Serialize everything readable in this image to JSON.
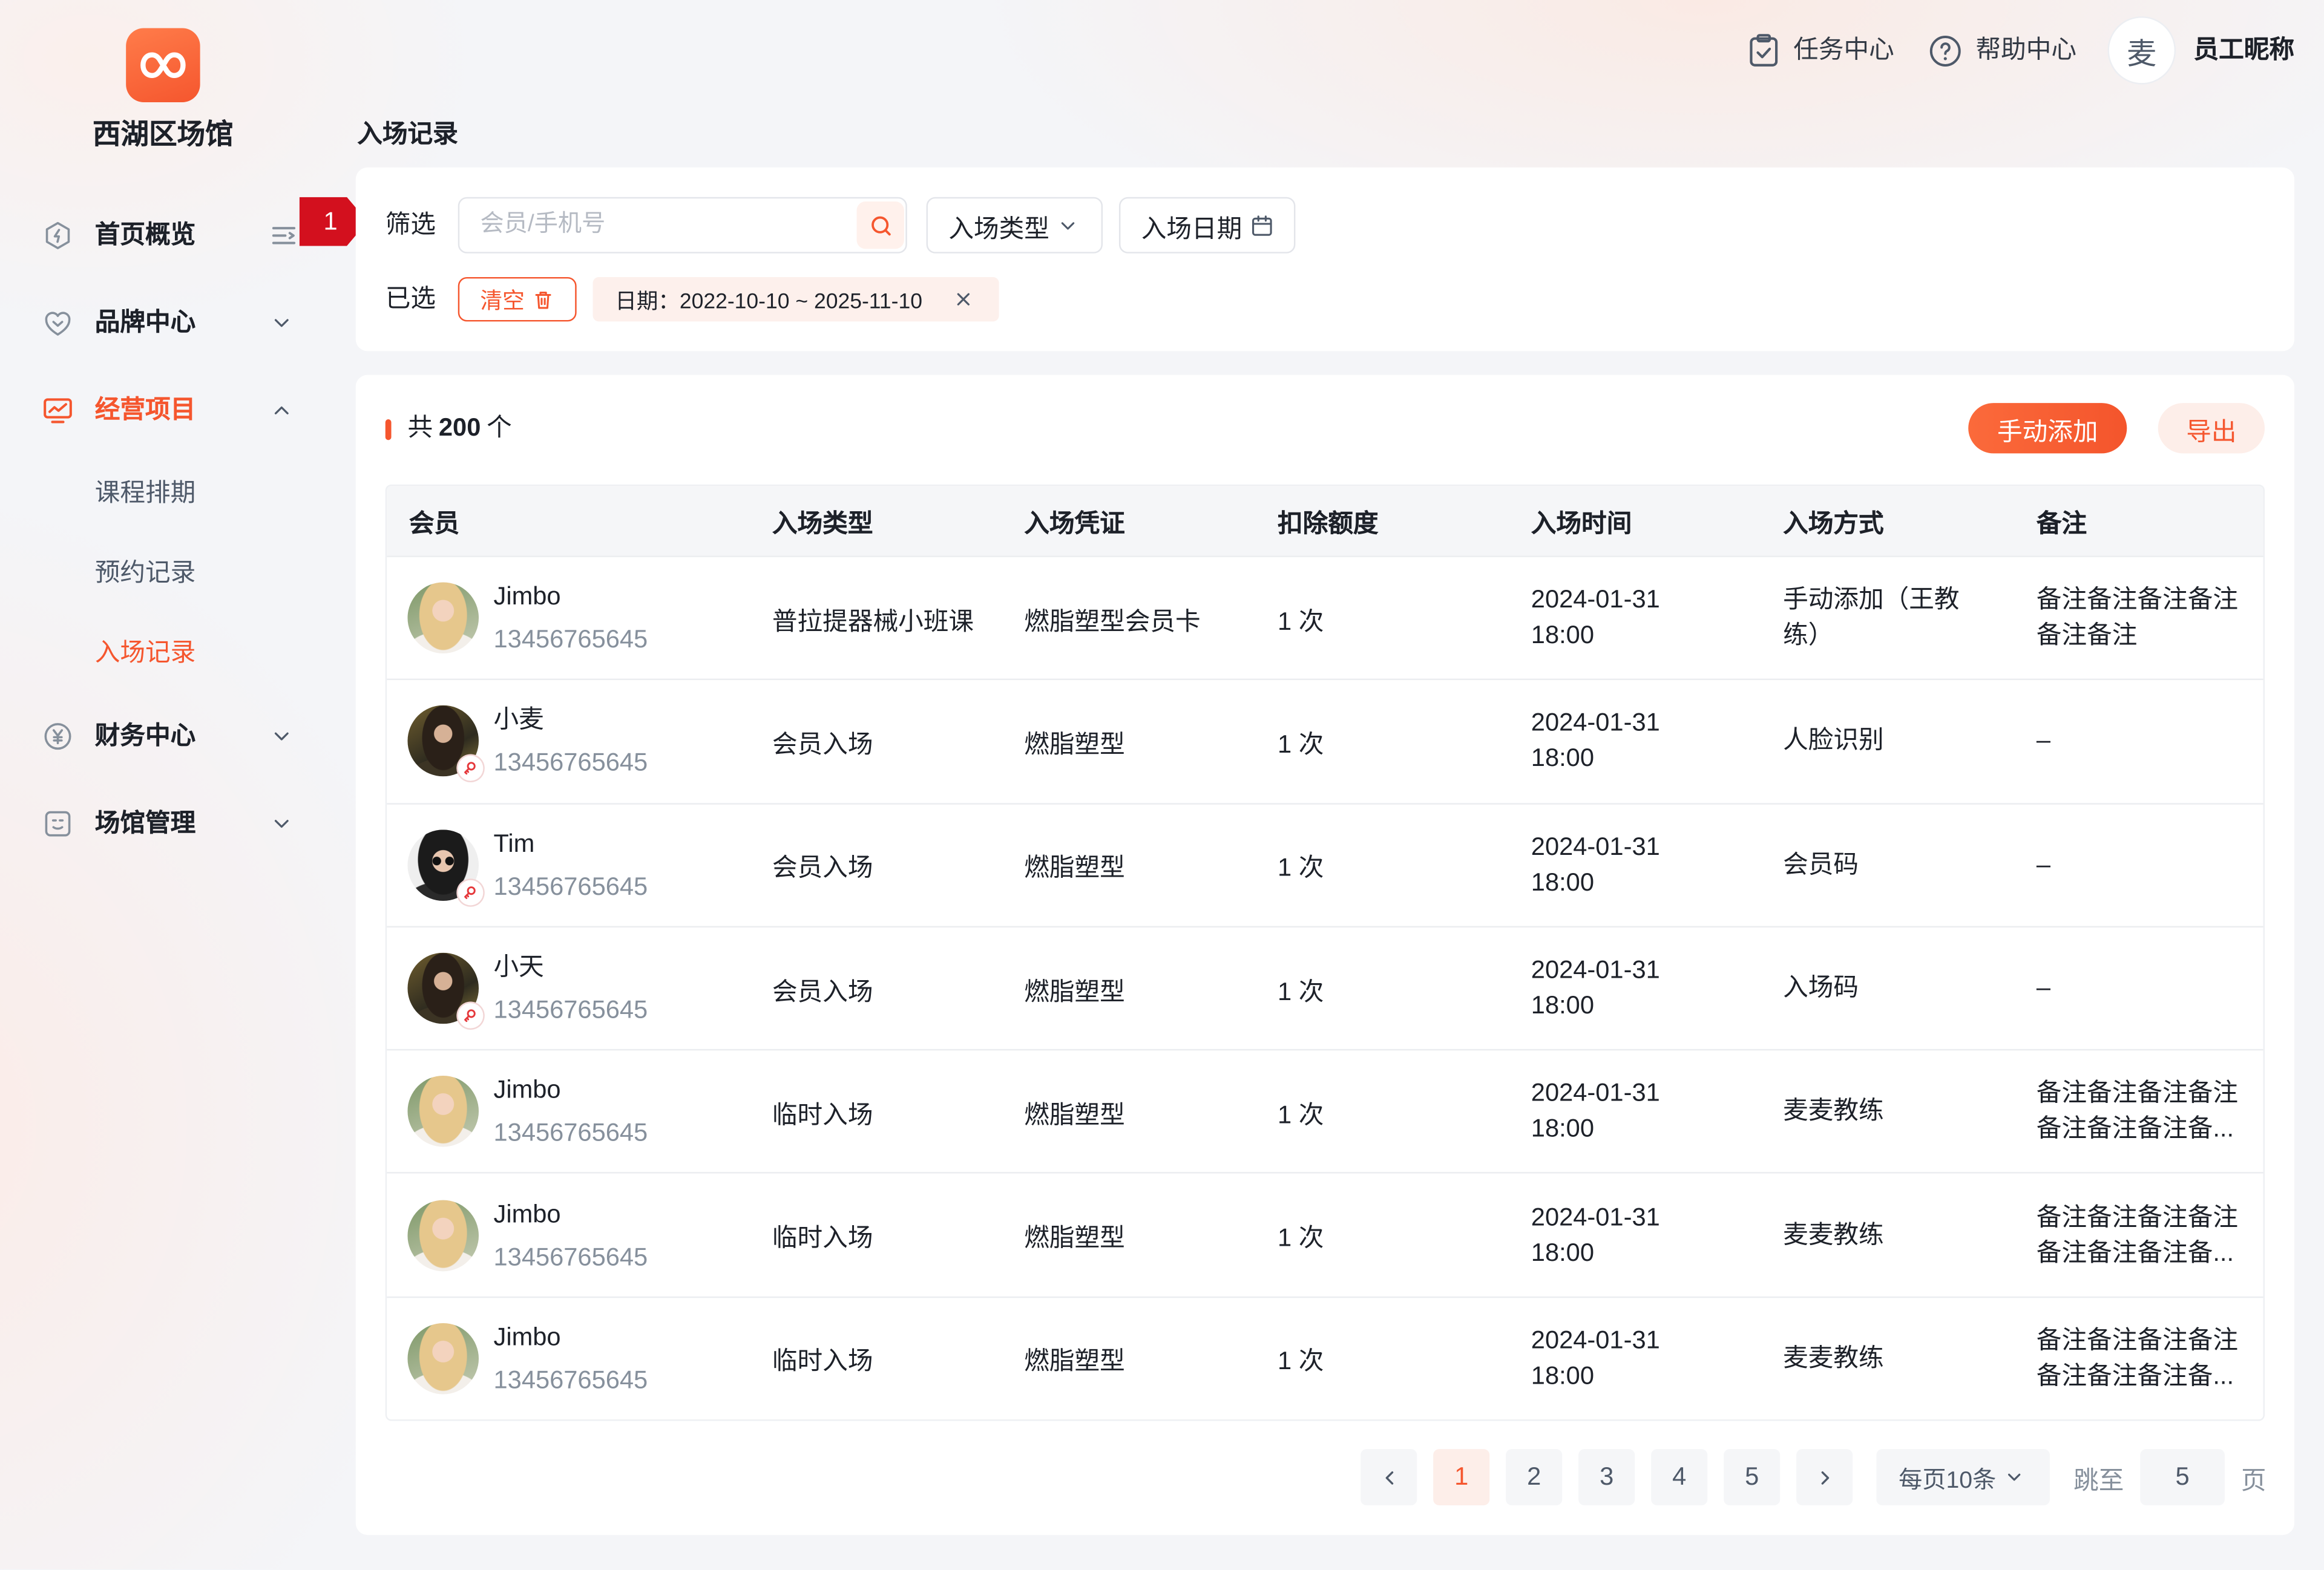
{
  "colors": {
    "accent": "#f5562e",
    "accent_light": "#fdeee9",
    "annotation": "#d3101e"
  },
  "sidebar": {
    "venue_name": "西湖区场馆",
    "logo_icon": "venue-logo-icon",
    "collapse_icon": "menu-fold-icon",
    "menu": [
      {
        "label": "首页概览",
        "icon": "home-icon"
      },
      {
        "label": "品牌中心",
        "icon": "brand-icon",
        "chevron": "chevron-down-icon"
      },
      {
        "label": "经营项目",
        "icon": "business-icon",
        "chevron": "chevron-up-icon",
        "active": true,
        "children": [
          {
            "label": "课程排期"
          },
          {
            "label": "预约记录"
          },
          {
            "label": "入场记录",
            "active": true
          }
        ]
      },
      {
        "label": "财务中心",
        "icon": "finance-icon",
        "chevron": "chevron-down-icon"
      },
      {
        "label": "场馆管理",
        "icon": "venue-icon",
        "chevron": "chevron-down-icon"
      }
    ]
  },
  "annotation": {
    "number": "1"
  },
  "header": {
    "task_center": "任务中心",
    "help_center": "帮助中心",
    "avatar_text": "麦",
    "user_name": "员工昵称"
  },
  "page_title": "入场记录",
  "filter": {
    "label": "筛选",
    "search_placeholder": "会员/手机号",
    "type_dropdown": "入场类型",
    "date_picker": "入场日期",
    "selected_label": "已选",
    "clear_label": "清空",
    "tag": "日期：2022-10-10 ~ 2025-11-10"
  },
  "list": {
    "prefix": "共",
    "count": "200",
    "suffix": "个",
    "add_button": "手动添加",
    "export_button": "导出",
    "columns": [
      "会员",
      "入场类型",
      "入场凭证",
      "扣除额度",
      "入场时间",
      "入场方式",
      "备注"
    ],
    "rows": [
      {
        "name": "Jimbo",
        "phone": "13456765645",
        "entry_type": "普拉提器械小班课",
        "credential": "燃脂塑型会员卡",
        "deduction": "1 次",
        "date": "2024-01-31",
        "time": "18:00",
        "method": "手动添加（王教练）",
        "note": "备注备注备注备注备注备注"
      },
      {
        "name": "小麦",
        "phone": "13456765645",
        "entry_type": "会员入场",
        "credential": "燃脂塑型",
        "deduction": "1 次",
        "date": "2024-01-31",
        "time": "18:00",
        "method": "人脸识别",
        "note": "–",
        "badge_icon": "face-recognition-icon"
      },
      {
        "name": "Tim",
        "phone": "13456765645",
        "entry_type": "会员入场",
        "credential": "燃脂塑型",
        "deduction": "1 次",
        "date": "2024-01-31",
        "time": "18:00",
        "method": "会员码",
        "note": "–",
        "badge_icon": "face-recognition-icon"
      },
      {
        "name": "小天",
        "phone": "13456765645",
        "entry_type": "会员入场",
        "credential": "燃脂塑型",
        "deduction": "1 次",
        "date": "2024-01-31",
        "time": "18:00",
        "method": "入场码",
        "note": "–",
        "badge_icon": "face-recognition-icon"
      },
      {
        "name": "Jimbo",
        "phone": "13456765645",
        "entry_type": "临时入场",
        "credential": "燃脂塑型",
        "deduction": "1 次",
        "date": "2024-01-31",
        "time": "18:00",
        "method": "麦麦教练",
        "note": "备注备注备注备注备注备注备注备..."
      },
      {
        "name": "Jimbo",
        "phone": "13456765645",
        "entry_type": "临时入场",
        "credential": "燃脂塑型",
        "deduction": "1 次",
        "date": "2024-01-31",
        "time": "18:00",
        "method": "麦麦教练",
        "note": "备注备注备注备注备注备注备注备..."
      },
      {
        "name": "Jimbo",
        "phone": "13456765645",
        "entry_type": "临时入场",
        "credential": "燃脂塑型",
        "deduction": "1 次",
        "date": "2024-01-31",
        "time": "18:00",
        "method": "麦麦教练",
        "note": "备注备注备注备注备注备注备注备..."
      }
    ]
  },
  "pagination": {
    "pages": [
      "1",
      "2",
      "3",
      "4",
      "5"
    ],
    "current_page": 1,
    "page_size": "每页10条",
    "jump_label": "跳至",
    "jump_value": "5",
    "page_unit": "页"
  }
}
